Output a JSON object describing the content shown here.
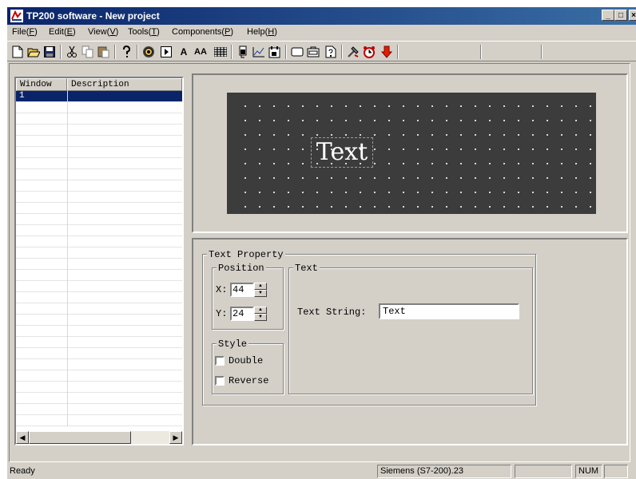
{
  "window": {
    "title": "TP200 software - New project",
    "controls": [
      "_",
      "□",
      "×"
    ]
  },
  "menu": [
    {
      "label": "File(",
      "key": "F",
      "end": ")"
    },
    {
      "label": "Edit(",
      "key": "E",
      "end": ")"
    },
    {
      "label": "View(",
      "key": "V",
      "end": ")"
    },
    {
      "label": "Tools(",
      "key": "T",
      "end": ")"
    },
    {
      "label": "Components(",
      "key": "P",
      "end": ")"
    },
    {
      "label": "Help(",
      "key": "H",
      "end": ")"
    }
  ],
  "toolbar": {
    "text_a": "A",
    "text_aa": "AA"
  },
  "window_list": {
    "columns": [
      "Window",
      "Description"
    ],
    "rows": [
      {
        "window": "1",
        "description": ""
      }
    ]
  },
  "preview": {
    "text": "Text"
  },
  "text_property": {
    "title": "Text Property",
    "position": {
      "title": "Position",
      "x_label": "X:",
      "x_value": "44",
      "y_label": "Y:",
      "y_value": "24"
    },
    "style": {
      "title": "Style",
      "double_label": "Double",
      "double_checked": false,
      "reverse_label": "Reverse",
      "reverse_checked": false
    },
    "text_group": {
      "title": "Text",
      "string_label": "Text String:",
      "string_value": "Text"
    }
  },
  "status": {
    "message": "Ready",
    "plc": "Siemens (S7-200).23",
    "num": "NUM"
  }
}
